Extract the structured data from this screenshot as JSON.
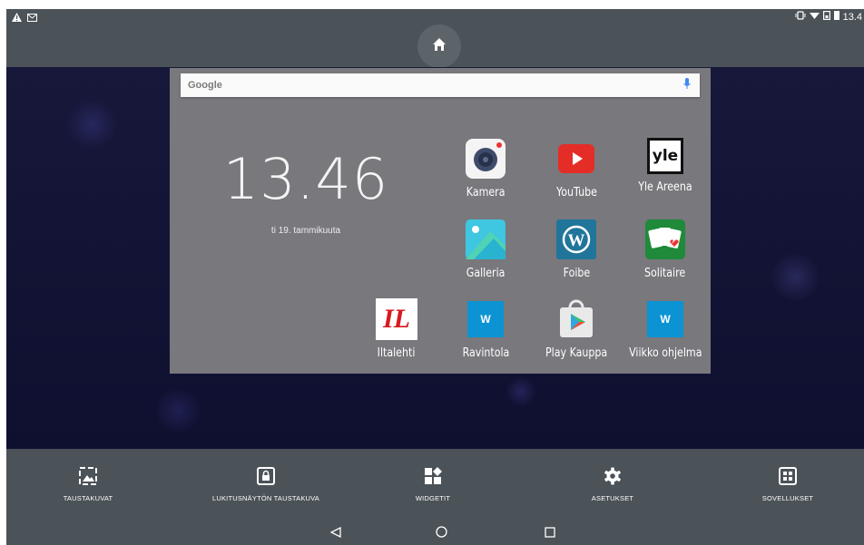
{
  "status_bar": {
    "left_icons": [
      "warning-icon",
      "email-icon"
    ],
    "right_icons": [
      "vibrate-icon",
      "wifi-icon",
      "sim-icon",
      "battery-icon"
    ],
    "time": "13.4"
  },
  "home_button": {
    "icon": "home-icon"
  },
  "preview": {
    "search": {
      "logo": "Google",
      "icon": "mic-icon"
    },
    "clock": {
      "time": "13.46",
      "date": "ti 19. tammikuuta"
    },
    "apps": [
      {
        "label": "Kamera",
        "icon": "camera-icon"
      },
      {
        "label": "YouTube",
        "icon": "youtube-icon"
      },
      {
        "label": "Yle Areena",
        "icon": "yle-icon",
        "icon_text": "yle"
      },
      {
        "label": "Galleria",
        "icon": "gallery-icon"
      },
      {
        "label": "Foibe",
        "icon": "wordpress-icon"
      },
      {
        "label": "Solitaire",
        "icon": "solitaire-icon"
      },
      {
        "label": "Iltalehti",
        "icon": "iltalehti-icon",
        "icon_text": "IL"
      },
      {
        "label": "Ravintola",
        "icon": "ravintola-icon",
        "icon_text": "W"
      },
      {
        "label": "Play Kauppa",
        "icon": "play-store-icon"
      },
      {
        "label": "Viikko ohjelma",
        "icon": "viikko-icon",
        "icon_text": "W"
      }
    ]
  },
  "options": [
    {
      "label": "TAUSTAKUVAT",
      "icon": "wallpaper-icon"
    },
    {
      "label": "LUKITUSNÄYTÖN TAUSTAKUVA",
      "icon": "lock-screen-icon"
    },
    {
      "label": "WIDGETIT",
      "icon": "widgets-icon"
    },
    {
      "label": "ASETUKSET",
      "icon": "settings-icon"
    },
    {
      "label": "SOVELLUKSET",
      "icon": "apps-icon"
    }
  ],
  "nav": [
    "back-icon",
    "home-circle-icon",
    "recents-icon"
  ],
  "colors": {
    "bar": "#4b5258",
    "preview_bg": "#78787d",
    "youtube_red": "#e52d27",
    "wp_blue": "#21759b",
    "w_blue": "#0c93d3"
  }
}
